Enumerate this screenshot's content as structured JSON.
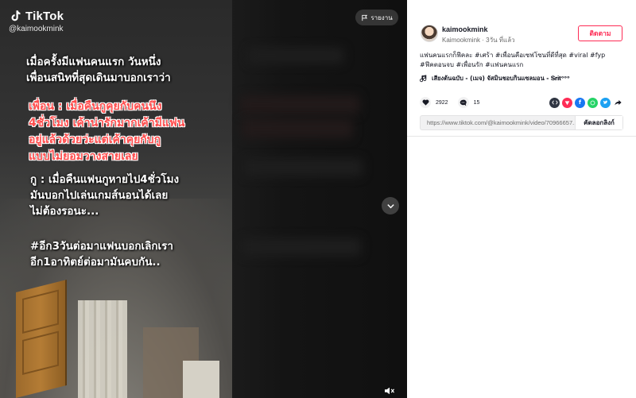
{
  "video": {
    "brand": "TikTok",
    "handle": "@kaimookmink",
    "report_label": "รายงาน",
    "caption_lines_1": "เมื่อครั้งมีแฟนคนแรก วันหนึ่ง\nเพื่อนสนิทที่สุดเดินมาบอกเราว่า",
    "caption_red": "เพื่อน : เมื่อคืนกูคุยกับคนนึง\n4ชั่วโมง เค้าน่ารักมากเค้ามีแฟน\nอยู่แล้วด้วยว่ะแต่เค้าคุยกับกู\nแบบไม่ยอมวางสายเลย",
    "caption_lines_2": "กู : เมื่อคืนแฟนกูหายไป4ชั่วโมง\nมันบอกไปเล่นเกมส์นอนได้เลย\nไม่ต้องรอนะ...",
    "caption_lines_3": "#อีก3วันต่อมาแฟนบอกเลิกเรา\nอีก1อาทิตย์ต่อมามันคบกัน.."
  },
  "author": {
    "username": "kaimookmink",
    "meta": "Kaimookmink · 3วัน ที่แล้ว",
    "follow_label": "ติดตาม"
  },
  "description": {
    "line1": "แฟนคนแรกก็ฟีคละ #เศร้า #เพื่อนคือเซฟโซนที่ดีที่สุด #viral #fyp",
    "line2": "#ฟีคตอนจบ #เพื่อนรัก #แฟนคนแรก"
  },
  "music": {
    "title": "เสียงต้นฉบับ - (เมจ) จัสมินชอบกินแซลมอน - 𝐒𝐫𝐢𝐭ᵒᵒᵒ"
  },
  "stats": {
    "likes": "2922",
    "comments": "15"
  },
  "share_icons": [
    "embed-icon",
    "tiktok-send-icon",
    "facebook-icon",
    "whatsapp-icon",
    "twitter-icon",
    "share-arrow-icon"
  ],
  "share_colors": {
    "embed": "#2f3542",
    "send": "#fe2c55",
    "facebook": "#1877f2",
    "whatsapp": "#25d366",
    "twitter": "#1da1f2"
  },
  "link": {
    "url": "https://www.tiktok.com/@kaimookmink/video/70966657...",
    "copy_label": "คัดลอกลิงก์"
  }
}
